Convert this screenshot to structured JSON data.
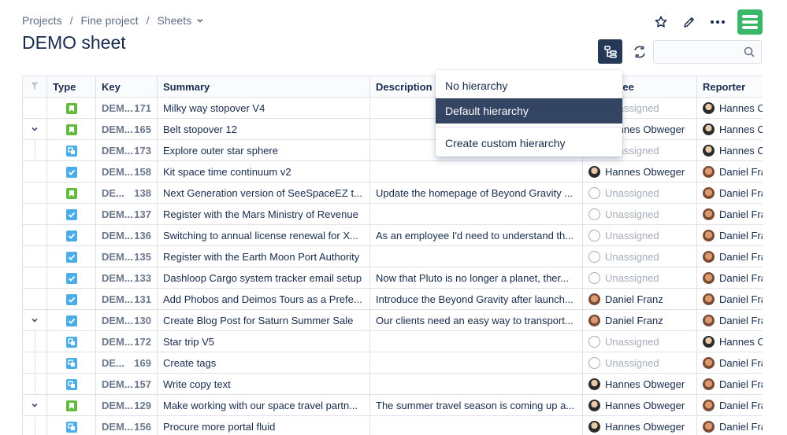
{
  "breadcrumb": {
    "items": [
      "Projects",
      "Fine project",
      "Sheets"
    ],
    "separator": "/"
  },
  "page_title": "DEMO sheet",
  "search": {
    "placeholder": ""
  },
  "dropdown": {
    "items": [
      "No hierarchy",
      "Default hierarchy",
      "Create custom hierarchy"
    ],
    "selected": "Default hierarchy"
  },
  "columns": [
    "",
    "Type",
    "Key",
    "Summary",
    "Description",
    "Assignee",
    "Reporter"
  ],
  "rows": [
    {
      "toggle": "",
      "type": "story",
      "key_a": "DEM...",
      "key_b": "171",
      "summary": "Milky way stopover V4",
      "description": "",
      "assignee": "Unassigned",
      "assignee_avatar": "none",
      "reporter": "Hannes Obweger",
      "reporter_avatar": "hannes"
    },
    {
      "toggle": "expand",
      "type": "story",
      "key_a": "DEM...",
      "key_b": "165",
      "summary": "Belt stopover 12",
      "description": "",
      "assignee": "Hannes Obweger",
      "assignee_avatar": "hannes",
      "reporter": "Hannes Obweger",
      "reporter_avatar": "hannes"
    },
    {
      "toggle": "child",
      "type": "subtask",
      "key_a": "DEM...",
      "key_b": "173",
      "summary": "Explore outer star sphere",
      "description": "",
      "assignee": "Unassigned",
      "assignee_avatar": "none",
      "reporter": "Hannes Obweger",
      "reporter_avatar": "hannes"
    },
    {
      "toggle": "",
      "type": "task",
      "key_a": "DEM...",
      "key_b": "158",
      "summary": "Kit space time continuum v2",
      "description": "",
      "assignee": "Hannes Obweger",
      "assignee_avatar": "hannes",
      "reporter": "Daniel Franz",
      "reporter_avatar": "daniel"
    },
    {
      "toggle": "",
      "type": "story",
      "key_a": "DE...",
      "key_b": "138",
      "summary": "Next Generation version of SeeSpaceEZ t...",
      "description": "Update the homepage of Beyond Gravity ...",
      "assignee": "Unassigned",
      "assignee_avatar": "none",
      "reporter": "Daniel Franz",
      "reporter_avatar": "daniel"
    },
    {
      "toggle": "",
      "type": "task",
      "key_a": "DEM...",
      "key_b": "137",
      "summary": "Register with the Mars Ministry of Revenue",
      "description": "",
      "assignee": "Unassigned",
      "assignee_avatar": "none",
      "reporter": "Daniel Franz",
      "reporter_avatar": "daniel"
    },
    {
      "toggle": "",
      "type": "task",
      "key_a": "DEM...",
      "key_b": "136",
      "summary": "Switching to annual license renewal for X...",
      "description": "As an employee I'd need to understand th...",
      "assignee": "Unassigned",
      "assignee_avatar": "none",
      "reporter": "Daniel Franz",
      "reporter_avatar": "daniel"
    },
    {
      "toggle": "",
      "type": "task",
      "key_a": "DEM...",
      "key_b": "135",
      "summary": "Register with the Earth Moon Port Authority",
      "description": "",
      "assignee": "Unassigned",
      "assignee_avatar": "none",
      "reporter": "Daniel Franz",
      "reporter_avatar": "daniel"
    },
    {
      "toggle": "",
      "type": "task",
      "key_a": "DEM...",
      "key_b": "133",
      "summary": "Dashloop Cargo system tracker email setup",
      "description": "Now that Pluto is no longer a planet, ther...",
      "assignee": "Unassigned",
      "assignee_avatar": "none",
      "reporter": "Daniel Franz",
      "reporter_avatar": "daniel"
    },
    {
      "toggle": "",
      "type": "task",
      "key_a": "DEM...",
      "key_b": "131",
      "summary": "Add Phobos and Deimos Tours as a Prefe...",
      "description": "Introduce the Beyond Gravity after launch...",
      "assignee": "Daniel Franz",
      "assignee_avatar": "daniel",
      "reporter": "Daniel Franz",
      "reporter_avatar": "daniel"
    },
    {
      "toggle": "expand",
      "type": "task",
      "key_a": "DEM...",
      "key_b": "130",
      "summary": "Create Blog Post for Saturn Summer Sale",
      "description": "Our clients need an easy way to transport...",
      "assignee": "Daniel Franz",
      "assignee_avatar": "daniel",
      "reporter": "Daniel Franz",
      "reporter_avatar": "daniel"
    },
    {
      "toggle": "child",
      "type": "subtask",
      "key_a": "DEM...",
      "key_b": "172",
      "summary": "Star trip V5",
      "description": "",
      "assignee": "Unassigned",
      "assignee_avatar": "none",
      "reporter": "Hannes Obweger",
      "reporter_avatar": "hannes"
    },
    {
      "toggle": "child",
      "type": "subtask",
      "key_a": "DE...",
      "key_b": "169",
      "summary": "Create tags",
      "description": "",
      "assignee": "Unassigned",
      "assignee_avatar": "none",
      "reporter": "Daniel Franz",
      "reporter_avatar": "daniel"
    },
    {
      "toggle": "child",
      "type": "subtask",
      "key_a": "DEM...",
      "key_b": "157",
      "summary": "Write copy text",
      "description": "",
      "assignee": "Hannes Obweger",
      "assignee_avatar": "hannes",
      "reporter": "Daniel Franz",
      "reporter_avatar": "daniel"
    },
    {
      "toggle": "expand",
      "type": "story",
      "key_a": "DEM...",
      "key_b": "129",
      "summary": "Make working with our space travel partn...",
      "description": "The summer travel season is coming up a...",
      "assignee": "Hannes Obweger",
      "assignee_avatar": "hannes",
      "reporter": "Daniel Franz",
      "reporter_avatar": "daniel"
    },
    {
      "toggle": "child",
      "type": "subtask",
      "key_a": "DEM...",
      "key_b": "156",
      "summary": "Procure more portal fluid",
      "description": "",
      "assignee": "Hannes Obweger",
      "assignee_avatar": "hannes",
      "reporter": "Daniel Franz",
      "reporter_avatar": "daniel"
    }
  ],
  "colors": {
    "story": "#63ba3c",
    "task": "#4bade8",
    "selected_menu": "#344563",
    "logo": "#3ab769"
  }
}
